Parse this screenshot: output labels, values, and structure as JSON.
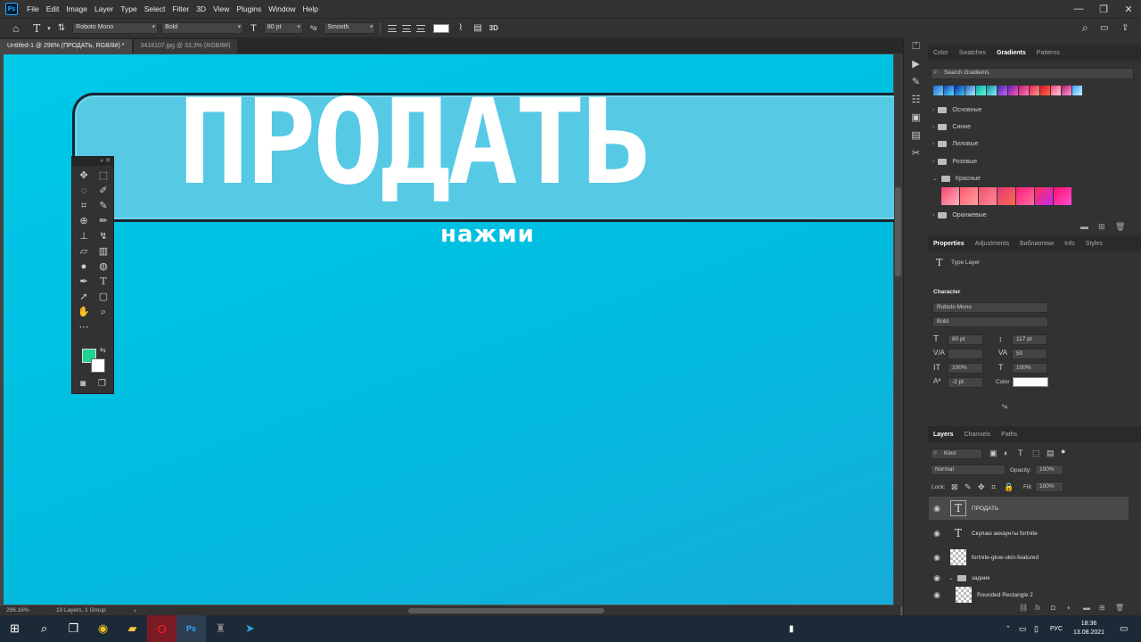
{
  "app": {
    "logo": "Ps",
    "menu": [
      "File",
      "Edit",
      "Image",
      "Layer",
      "Type",
      "Select",
      "Filter",
      "3D",
      "View",
      "Plugins",
      "Window",
      "Help"
    ],
    "window_controls": [
      "—",
      "❐",
      "✕"
    ]
  },
  "options_bar": {
    "font_family": "Roboto Mono",
    "font_style": "Bold",
    "font_size": "80 pt",
    "aa_label": "ªa",
    "anti_alias": "Smooth",
    "mode_3d": "3D"
  },
  "tabs": [
    {
      "label": "Untitled-1 @ 296% (ПРОДАТЬ, RGB/8#) *"
    },
    {
      "label": "3418107.jpg @ 33,3% (RGB/8#)"
    }
  ],
  "canvas": {
    "headline": "ПРОДАТЬ",
    "subline": "нажми"
  },
  "status": {
    "zoom": "296.16%",
    "info": "10 Layers, 1 Group"
  },
  "colors": {
    "foreground": "#1ed290",
    "background": "#ffffff",
    "canvas_accent": "#00c3e6"
  },
  "gradients_panel": {
    "tabs": [
      "Color",
      "Swatches",
      "Gradients",
      "Patterns"
    ],
    "active_tab": "Gradients",
    "search_placeholder": "Search Gradients",
    "folders": [
      "Основные",
      "Синие",
      "Лиловые",
      "Розовые",
      "Красные",
      "Оранжевые"
    ]
  },
  "properties_panel": {
    "tabs": [
      "Properties",
      "Adjustments",
      "Библиотеки",
      "Info",
      "Styles"
    ],
    "active_tab": "Properties",
    "type_layer_label": "Type Layer",
    "character_header": "Character",
    "font_family": "Roboto Mono",
    "font_style": "Bold",
    "font_size": "80 pt",
    "leading": "117 pt",
    "tracking": "50",
    "vertical_scale": "100%",
    "horizontal_scale": "100%",
    "baseline_shift": "-2 pt",
    "color_label": "Color",
    "aa_label": "ªa"
  },
  "layers_panel": {
    "tabs": [
      "Layers",
      "Channels",
      "Paths"
    ],
    "active_tab": "Layers",
    "filter_kind": "Kind",
    "blend_mode": "Normal",
    "opacity_label": "Opacity:",
    "opacity": "100%",
    "lock_label": "Lock:",
    "fill_label": "Fill:",
    "fill": "100%",
    "layers": [
      {
        "name": "ПРОДАТЬ",
        "kind": "type",
        "selected": true
      },
      {
        "name": "Скупаю аккаунты fortnite",
        "kind": "type",
        "selected": false
      },
      {
        "name": "fortnite-glow-skin-featured",
        "kind": "image",
        "selected": false
      },
      {
        "name": "задник",
        "kind": "group",
        "selected": false
      },
      {
        "name": "Rounded Rectangle 2",
        "kind": "shape",
        "selected": false
      }
    ]
  },
  "taskbar": {
    "language": "РУС",
    "time": "18:36",
    "date": "13.08.2021"
  }
}
